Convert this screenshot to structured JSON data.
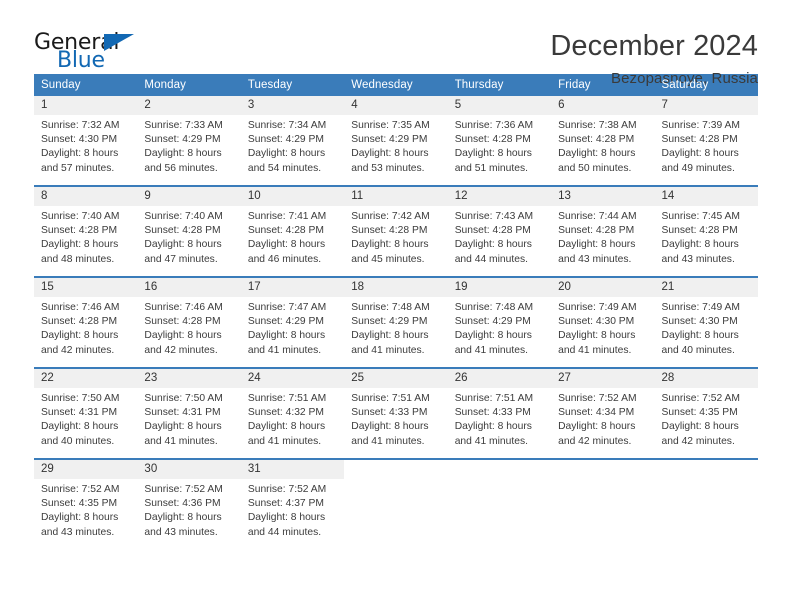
{
  "brand": {
    "name_part1": "General",
    "name_part2": "Blue",
    "accent_color": "#1268b3"
  },
  "header": {
    "title": "December 2024",
    "subtitle": "Bezopasnoye, Russia"
  },
  "theme": {
    "header_row_bg": "#3a7cba",
    "daynum_bg": "#f0f0f0",
    "text_color": "#333333"
  },
  "calendar": {
    "weekday_headers": [
      "Sunday",
      "Monday",
      "Tuesday",
      "Wednesday",
      "Thursday",
      "Friday",
      "Saturday"
    ],
    "weeks": [
      [
        {
          "day": "1",
          "sunrise": "Sunrise: 7:32 AM",
          "sunset": "Sunset: 4:30 PM",
          "daylight": "Daylight: 8 hours and 57 minutes."
        },
        {
          "day": "2",
          "sunrise": "Sunrise: 7:33 AM",
          "sunset": "Sunset: 4:29 PM",
          "daylight": "Daylight: 8 hours and 56 minutes."
        },
        {
          "day": "3",
          "sunrise": "Sunrise: 7:34 AM",
          "sunset": "Sunset: 4:29 PM",
          "daylight": "Daylight: 8 hours and 54 minutes."
        },
        {
          "day": "4",
          "sunrise": "Sunrise: 7:35 AM",
          "sunset": "Sunset: 4:29 PM",
          "daylight": "Daylight: 8 hours and 53 minutes."
        },
        {
          "day": "5",
          "sunrise": "Sunrise: 7:36 AM",
          "sunset": "Sunset: 4:28 PM",
          "daylight": "Daylight: 8 hours and 51 minutes."
        },
        {
          "day": "6",
          "sunrise": "Sunrise: 7:38 AM",
          "sunset": "Sunset: 4:28 PM",
          "daylight": "Daylight: 8 hours and 50 minutes."
        },
        {
          "day": "7",
          "sunrise": "Sunrise: 7:39 AM",
          "sunset": "Sunset: 4:28 PM",
          "daylight": "Daylight: 8 hours and 49 minutes."
        }
      ],
      [
        {
          "day": "8",
          "sunrise": "Sunrise: 7:40 AM",
          "sunset": "Sunset: 4:28 PM",
          "daylight": "Daylight: 8 hours and 48 minutes."
        },
        {
          "day": "9",
          "sunrise": "Sunrise: 7:40 AM",
          "sunset": "Sunset: 4:28 PM",
          "daylight": "Daylight: 8 hours and 47 minutes."
        },
        {
          "day": "10",
          "sunrise": "Sunrise: 7:41 AM",
          "sunset": "Sunset: 4:28 PM",
          "daylight": "Daylight: 8 hours and 46 minutes."
        },
        {
          "day": "11",
          "sunrise": "Sunrise: 7:42 AM",
          "sunset": "Sunset: 4:28 PM",
          "daylight": "Daylight: 8 hours and 45 minutes."
        },
        {
          "day": "12",
          "sunrise": "Sunrise: 7:43 AM",
          "sunset": "Sunset: 4:28 PM",
          "daylight": "Daylight: 8 hours and 44 minutes."
        },
        {
          "day": "13",
          "sunrise": "Sunrise: 7:44 AM",
          "sunset": "Sunset: 4:28 PM",
          "daylight": "Daylight: 8 hours and 43 minutes."
        },
        {
          "day": "14",
          "sunrise": "Sunrise: 7:45 AM",
          "sunset": "Sunset: 4:28 PM",
          "daylight": "Daylight: 8 hours and 43 minutes."
        }
      ],
      [
        {
          "day": "15",
          "sunrise": "Sunrise: 7:46 AM",
          "sunset": "Sunset: 4:28 PM",
          "daylight": "Daylight: 8 hours and 42 minutes."
        },
        {
          "day": "16",
          "sunrise": "Sunrise: 7:46 AM",
          "sunset": "Sunset: 4:28 PM",
          "daylight": "Daylight: 8 hours and 42 minutes."
        },
        {
          "day": "17",
          "sunrise": "Sunrise: 7:47 AM",
          "sunset": "Sunset: 4:29 PM",
          "daylight": "Daylight: 8 hours and 41 minutes."
        },
        {
          "day": "18",
          "sunrise": "Sunrise: 7:48 AM",
          "sunset": "Sunset: 4:29 PM",
          "daylight": "Daylight: 8 hours and 41 minutes."
        },
        {
          "day": "19",
          "sunrise": "Sunrise: 7:48 AM",
          "sunset": "Sunset: 4:29 PM",
          "daylight": "Daylight: 8 hours and 41 minutes."
        },
        {
          "day": "20",
          "sunrise": "Sunrise: 7:49 AM",
          "sunset": "Sunset: 4:30 PM",
          "daylight": "Daylight: 8 hours and 41 minutes."
        },
        {
          "day": "21",
          "sunrise": "Sunrise: 7:49 AM",
          "sunset": "Sunset: 4:30 PM",
          "daylight": "Daylight: 8 hours and 40 minutes."
        }
      ],
      [
        {
          "day": "22",
          "sunrise": "Sunrise: 7:50 AM",
          "sunset": "Sunset: 4:31 PM",
          "daylight": "Daylight: 8 hours and 40 minutes."
        },
        {
          "day": "23",
          "sunrise": "Sunrise: 7:50 AM",
          "sunset": "Sunset: 4:31 PM",
          "daylight": "Daylight: 8 hours and 41 minutes."
        },
        {
          "day": "24",
          "sunrise": "Sunrise: 7:51 AM",
          "sunset": "Sunset: 4:32 PM",
          "daylight": "Daylight: 8 hours and 41 minutes."
        },
        {
          "day": "25",
          "sunrise": "Sunrise: 7:51 AM",
          "sunset": "Sunset: 4:33 PM",
          "daylight": "Daylight: 8 hours and 41 minutes."
        },
        {
          "day": "26",
          "sunrise": "Sunrise: 7:51 AM",
          "sunset": "Sunset: 4:33 PM",
          "daylight": "Daylight: 8 hours and 41 minutes."
        },
        {
          "day": "27",
          "sunrise": "Sunrise: 7:52 AM",
          "sunset": "Sunset: 4:34 PM",
          "daylight": "Daylight: 8 hours and 42 minutes."
        },
        {
          "day": "28",
          "sunrise": "Sunrise: 7:52 AM",
          "sunset": "Sunset: 4:35 PM",
          "daylight": "Daylight: 8 hours and 42 minutes."
        }
      ],
      [
        {
          "day": "29",
          "sunrise": "Sunrise: 7:52 AM",
          "sunset": "Sunset: 4:35 PM",
          "daylight": "Daylight: 8 hours and 43 minutes."
        },
        {
          "day": "30",
          "sunrise": "Sunrise: 7:52 AM",
          "sunset": "Sunset: 4:36 PM",
          "daylight": "Daylight: 8 hours and 43 minutes."
        },
        {
          "day": "31",
          "sunrise": "Sunrise: 7:52 AM",
          "sunset": "Sunset: 4:37 PM",
          "daylight": "Daylight: 8 hours and 44 minutes."
        },
        {
          "day": "",
          "sunrise": "",
          "sunset": "",
          "daylight": ""
        },
        {
          "day": "",
          "sunrise": "",
          "sunset": "",
          "daylight": ""
        },
        {
          "day": "",
          "sunrise": "",
          "sunset": "",
          "daylight": ""
        },
        {
          "day": "",
          "sunrise": "",
          "sunset": "",
          "daylight": ""
        }
      ]
    ]
  }
}
